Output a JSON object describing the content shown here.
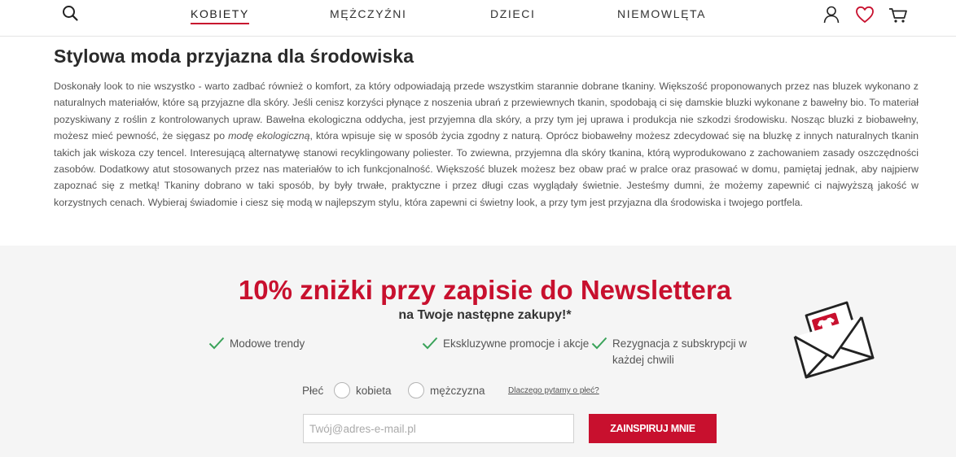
{
  "header": {
    "nav": [
      {
        "label": "KOBIETY",
        "active": true
      },
      {
        "label": "MĘŻCZYŹNI",
        "active": false
      },
      {
        "label": "DZIECI",
        "active": false
      },
      {
        "label": "NIEMOWLĘTA",
        "active": false
      }
    ],
    "icons": [
      "search-icon",
      "user-icon",
      "heart-icon",
      "cart-icon"
    ],
    "accent_color": "#c8102e"
  },
  "article": {
    "title": "Stylowa moda przyjazna dla środowiska",
    "body_before_em": "Doskonały look to nie wszystko - warto zadbać również o komfort, za który odpowiadają przede wszystkim starannie dobrane tkaniny. Większość proponowanych przez nas bluzek wykonano z naturalnych materiałów, które są przyjazne dla skóry. Jeśli cenisz korzyści płynące z noszenia ubrań z przewiewnych tkanin, spodobają ci się damskie bluzki wykonane z bawełny bio. To materiał pozyskiwany z roślin z kontrolowanych upraw. Bawełna ekologiczna oddycha, jest przyjemna dla skóry, a przy tym jej uprawa i produkcja nie szkodzi środowisku. Nosząc bluzki z biobawełny, możesz mieć pewność, że sięgasz po ",
    "body_em": "modę ekologiczną",
    "body_after_em": ", która wpisuje się w sposób życia zgodny z naturą. Oprócz biobawełny możesz zdecydować się na bluzkę z innych naturalnych tkanin takich jak wiskoza czy tencel. Interesującą alternatywę stanowi recyklingowany poliester. To zwiewna, przyjemna dla skóry tkanina, którą wyprodukowano z zachowaniem zasady oszczędności zasobów. Dodatkowy atut stosowanych przez nas materiałów to ich funkcjonalność. Większość bluzek możesz bez obaw prać w pralce oraz prasować w domu, pamiętaj jednak, aby najpierw zapoznać się z metką! Tkaniny dobrano w taki sposób, by były trwałe, praktyczne i przez długi czas wyglądały świetnie. Jesteśmy dumni, że możemy zapewnić ci najwyższą jakość w korzystnych cenach. Wybieraj świadomie i ciesz się modą w najlepszym stylu, która zapewni ci świetny look, a przy tym jest przyjazna dla środowiska i twojego portfela."
  },
  "newsletter": {
    "title": "10% zniżki przy zapisie do Newslettera",
    "subtitle": "na Twoje następne zakupy!*",
    "benefits": [
      "Modowe trendy",
      "Ekskluzywne promocje i akcje",
      "Rezygnacja z subskrypcji w każdej chwili"
    ],
    "gender_label": "Płeć",
    "gender_options": [
      "kobieta",
      "mężczyzna"
    ],
    "why_link": "Dlaczego pytamy o płeć?",
    "email_placeholder": "Twój@adres-e-mail.pl",
    "email_value": "",
    "submit_label": "ZAINSPIRUJ MNIE",
    "check_color": "#3aa35a",
    "title_color": "#c8102e"
  }
}
